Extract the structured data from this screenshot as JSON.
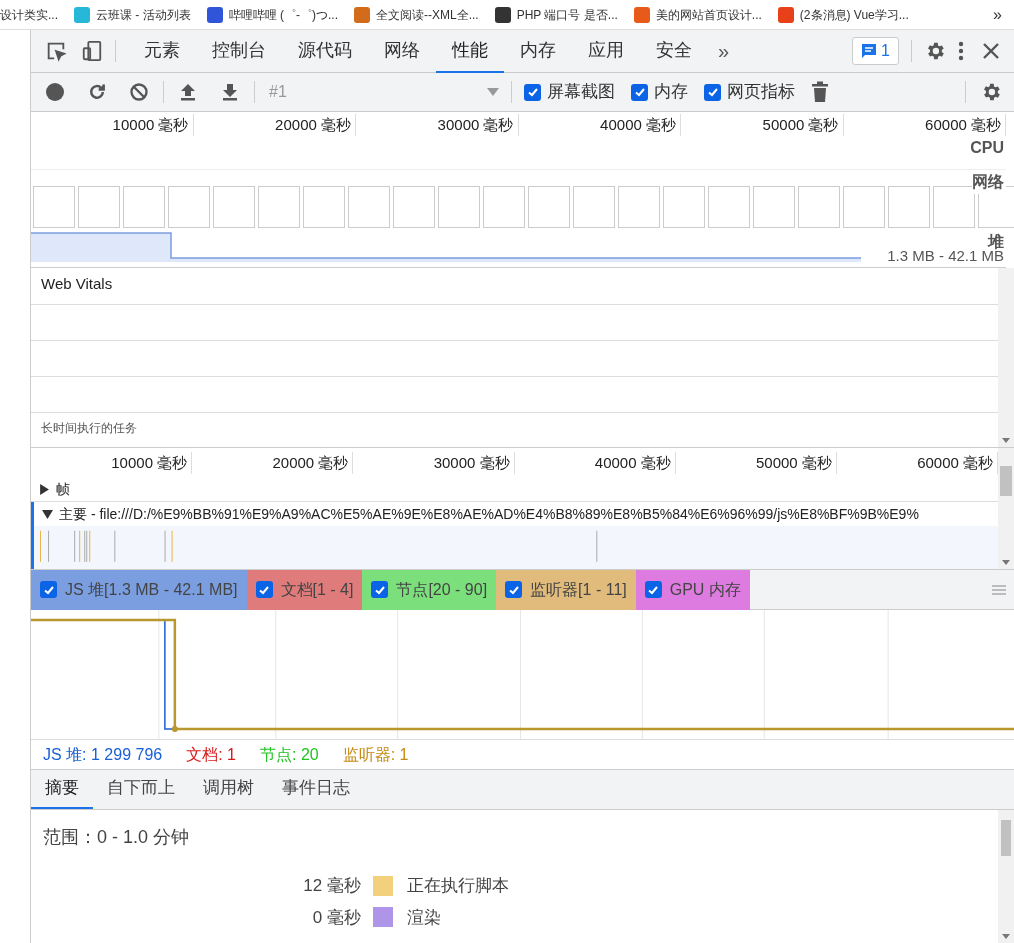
{
  "bookmarks": [
    {
      "label": "设计类实..."
    },
    {
      "label": "云班课 - 活动列表"
    },
    {
      "label": "哔哩哔哩 (゜-゜)つ..."
    },
    {
      "label": "全文阅读--XML全..."
    },
    {
      "label": "PHP 端口号 是否..."
    },
    {
      "label": "美的网站首页设计..."
    },
    {
      "label": "(2条消息) Vue学习..."
    }
  ],
  "bookmarks_more": "»",
  "devtools_tabs": [
    {
      "label": "元素",
      "selected": false
    },
    {
      "label": "控制台",
      "selected": false
    },
    {
      "label": "源代码",
      "selected": false
    },
    {
      "label": "网络",
      "selected": false
    },
    {
      "label": "性能",
      "selected": true
    },
    {
      "label": "内存",
      "selected": false
    },
    {
      "label": "应用",
      "selected": false
    },
    {
      "label": "安全",
      "selected": false
    }
  ],
  "tabs_more": "»",
  "issues_count": "1",
  "toolbar": {
    "recording_select": "#1",
    "options": [
      {
        "label": "屏幕截图",
        "checked": true
      },
      {
        "label": "内存",
        "checked": true
      },
      {
        "label": "网页指标",
        "checked": true
      }
    ]
  },
  "overview": {
    "ticks": [
      "10000 毫秒",
      "20000 毫秒",
      "30000 毫秒",
      "40000 毫秒",
      "50000 毫秒",
      "60000 毫秒"
    ],
    "cpu_label": "CPU",
    "network_label": "网络",
    "heap_label": "堆",
    "heap_range": "1.3 MB - 42.1 MB"
  },
  "web_vitals": {
    "title": "Web Vitals",
    "long_tasks_label": "长时间执行的任务"
  },
  "timeline": {
    "ticks": [
      "10000 毫秒",
      "20000 毫秒",
      "30000 毫秒",
      "40000 毫秒",
      "50000 毫秒",
      "60000 毫秒"
    ],
    "tracks": [
      {
        "label": "帧",
        "expanded": false
      },
      {
        "label": "主要 - file:///D:/%E9%BB%91%E9%A9%AC%E5%AE%9E%E8%AE%AD%E4%B8%89%E8%B5%84%E6%96%99/js%E8%BF%9B%E9%",
        "expanded": true
      }
    ]
  },
  "counters": [
    {
      "label": "JS 堆[1.3 MB - 42.1 MB]",
      "checked": true,
      "color": "#7b9ee0"
    },
    {
      "label": "文档[1 - 4]",
      "checked": true,
      "color": "#e07b7b"
    },
    {
      "label": "节点[20 - 90]",
      "checked": true,
      "color": "#7be07b"
    },
    {
      "label": "监听器[1 - 11]",
      "checked": true,
      "color": "#e0bb7b"
    },
    {
      "label": "GPU 内存",
      "checked": true,
      "color": "#de7be0"
    }
  ],
  "counter_values": [
    {
      "label": "JS 堆: 1 299 796",
      "color": "#1a5fd6"
    },
    {
      "label": "文档: 1",
      "color": "#d61a1a"
    },
    {
      "label": "节点: 20",
      "color": "#22c322"
    },
    {
      "label": "监听器: 1",
      "color": "#c48a12"
    }
  ],
  "bottom_tabs": [
    {
      "label": "摘要",
      "selected": true
    },
    {
      "label": "自下而上",
      "selected": false
    },
    {
      "label": "调用树",
      "selected": false
    },
    {
      "label": "事件日志",
      "selected": false
    }
  ],
  "summary": {
    "range": "范围：0 - 1.0 分钟",
    "rows": [
      {
        "time": "12 毫秒",
        "label": "正在执行脚本",
        "color": "#f2d07c"
      },
      {
        "time": "0 毫秒",
        "label": "渲染",
        "color": "#ae95e8"
      }
    ]
  }
}
